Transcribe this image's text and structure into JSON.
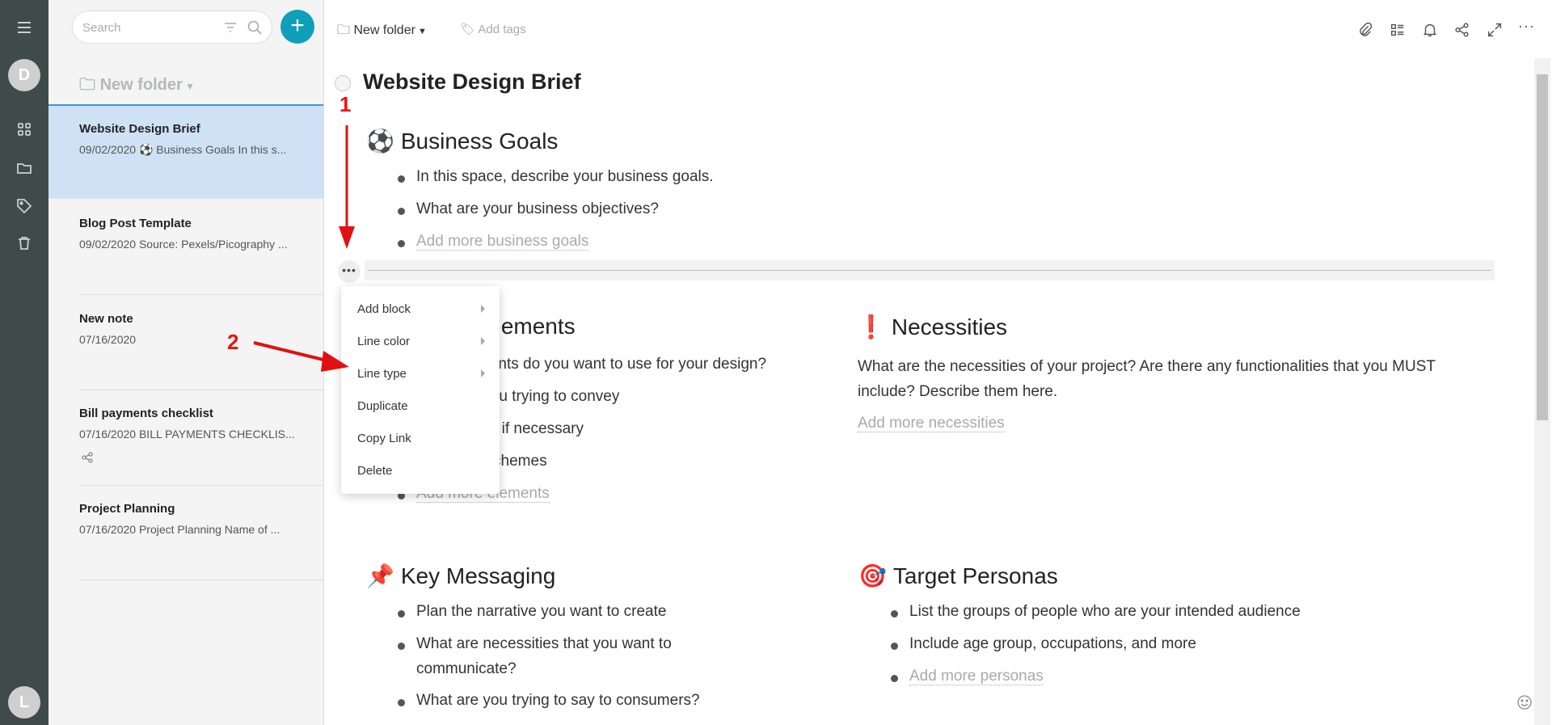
{
  "rail": {
    "user_initial": "D",
    "bottom_initial": "L",
    "icons": [
      "menu-icon",
      "grid-icon",
      "folder-icon",
      "tag-icon",
      "trash-icon"
    ]
  },
  "list": {
    "search_placeholder": "Search",
    "folder": "New folder",
    "notes": [
      {
        "title": "Website Design Brief",
        "date": "09/02/2020",
        "preview": "Business Goals In this s...",
        "emoji": "⚽"
      },
      {
        "title": "Blog Post Template",
        "date": "09/02/2020",
        "preview": "Source: Pexels/Picography ..."
      },
      {
        "title": "New note",
        "date": "07/16/2020",
        "preview": ""
      },
      {
        "title": "Bill payments checklist",
        "date": "07/16/2020",
        "preview": "BILL PAYMENTS CHECKLIS..."
      },
      {
        "title": "Project Planning",
        "date": "07/16/2020",
        "preview": "Project Planning Name of ..."
      }
    ]
  },
  "topbar": {
    "folder": "New folder",
    "add_tags": "Add tags"
  },
  "doc": {
    "title": "Website Design Brief",
    "business": {
      "emoji": "⚽",
      "heading": "Business Goals",
      "items": [
        "In this space, describe your business goals.",
        "What are your business objectives?"
      ],
      "add": "Add more business goals"
    },
    "design": {
      "heading": "Design Elements",
      "items": [
        "What elements do you want to use for your design?",
        "What are you trying to convey",
        "Add images if necessary",
        "Add color schemes"
      ],
      "add": "Add more elements"
    },
    "necessities": {
      "emoji": "❗",
      "heading": "Necessities",
      "line1": "What are the necessities of your project? Are there any functionalities that you MUST",
      "line2": "include? Describe them here.",
      "add": "Add more necessities"
    },
    "messaging": {
      "emoji": "📌",
      "heading": "Key Messaging",
      "items": [
        "Plan the narrative you want to create",
        "What are necessities that you want to",
        "communicate?",
        "What are you trying to say to consumers?"
      ]
    },
    "personas": {
      "emoji": "🎯",
      "heading": "Target Personas",
      "items": [
        "List the groups of people who are your intended audience",
        "Include age group, occupations, and more"
      ],
      "add": "Add more personas"
    }
  },
  "menu": {
    "items": [
      "Add block",
      "Line color",
      "Line type",
      "Duplicate",
      "Copy Link",
      "Delete"
    ]
  },
  "annotations": {
    "one": "1",
    "two": "2",
    "color": "#e11111"
  },
  "colors": {
    "accent": "#0f9fb9",
    "rail": "#3f4a4a",
    "selected": "#cfe2f5"
  }
}
